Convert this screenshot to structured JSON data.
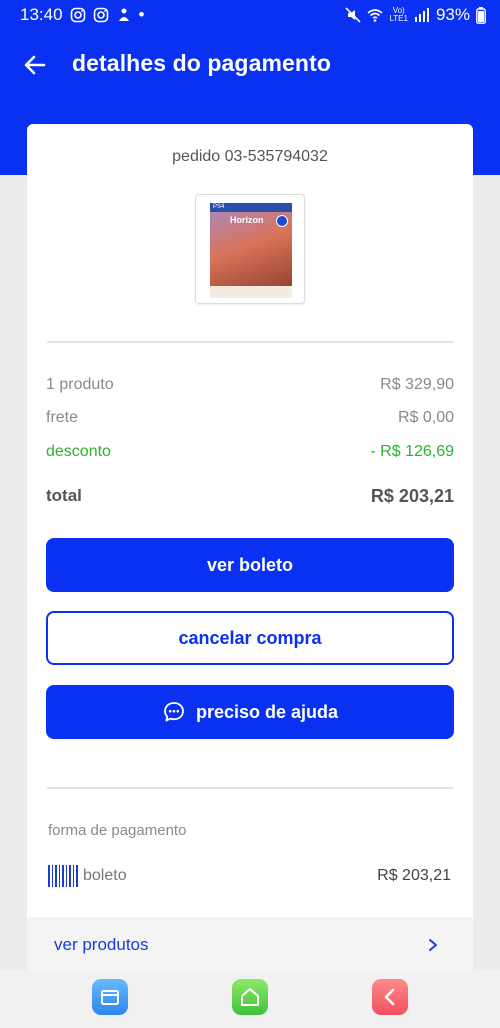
{
  "status_bar": {
    "time": "13:40",
    "battery": "93%",
    "network_top": "Vo)",
    "network_bottom": "LTE1"
  },
  "header": {
    "title": "detalhes do pagamento"
  },
  "order": {
    "id_text": "pedido 03-535794032"
  },
  "summary": {
    "products_label": "1 produto",
    "products_value": "R$ 329,90",
    "shipping_label": "frete",
    "shipping_value": "R$ 0,00",
    "discount_label": "desconto",
    "discount_value": "- R$ 126,69",
    "total_label": "total",
    "total_value": "R$ 203,21"
  },
  "buttons": {
    "view_boleto": "ver boleto",
    "cancel_purchase": "cancelar compra",
    "need_help": "preciso de ajuda"
  },
  "payment": {
    "section_label": "forma de pagamento",
    "method": "boleto",
    "amount": "R$ 203,21"
  },
  "products_link": {
    "label": "ver produtos"
  },
  "colors": {
    "primary": "#0a31f2",
    "discount": "#2bb32b"
  },
  "icons": [
    "back-arrow-icon",
    "chat-bubble-icon",
    "barcode-icon",
    "chevron-right-icon",
    "recent-apps-icon",
    "home-icon",
    "back-icon"
  ]
}
